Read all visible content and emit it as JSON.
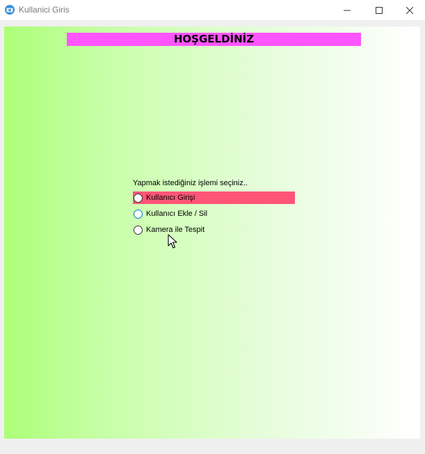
{
  "window": {
    "title": "Kullanici Giris",
    "app_icon": "app-icon",
    "controls": [
      "minimize-icon",
      "maximize-icon",
      "close-icon"
    ]
  },
  "banner": {
    "text": "HOŞGELDİNİZ",
    "color": "#ff55ff"
  },
  "prompt": "Yapmak istediğiniz işlemi seçiniz..",
  "options": [
    {
      "label": "Kullanıcı Girişi",
      "highlighted": true
    },
    {
      "label": "Kullanıcı Ekle / Sil",
      "highlighted": false
    },
    {
      "label": "Kamera ile Tespit",
      "highlighted": false
    }
  ],
  "colors": {
    "highlight": "#ff5577",
    "gradient_start": "#acff78",
    "gradient_end": "#ffffff"
  }
}
